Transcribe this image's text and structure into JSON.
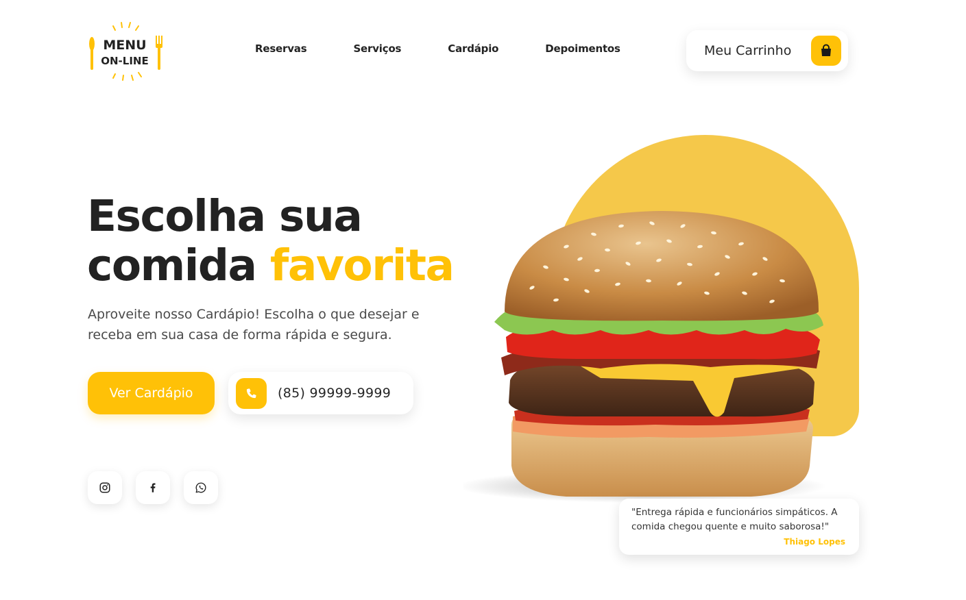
{
  "logo": {
    "line1": "MENU",
    "line2": "ON-LINE"
  },
  "nav": {
    "items": [
      {
        "label": "Reservas"
      },
      {
        "label": "Serviços"
      },
      {
        "label": "Cardápio"
      },
      {
        "label": "Depoimentos"
      }
    ]
  },
  "cart": {
    "label": "Meu Carrinho",
    "icon": "shopping-bag-icon"
  },
  "hero": {
    "title_line1": "Escolha sua",
    "title_line2_plain": "comida ",
    "title_line2_accent": "favorita",
    "subtitle": "Aproveite nosso Cardápio! Escolha o que desejar e receba em sua casa de forma rápida e segura.",
    "cta_label": "Ver Cardápio",
    "phone": "(85) 99999-9999"
  },
  "social": [
    {
      "icon": "instagram-icon"
    },
    {
      "icon": "facebook-icon"
    },
    {
      "icon": "whatsapp-icon"
    }
  ],
  "testimonial": {
    "quote": "\"Entrega rápida e funcionários simpáticos. A comida chegou quente e muito saborosa!\"",
    "author": "Thiago Lopes"
  },
  "colors": {
    "accent": "#FFC107",
    "shape": "#F5C84A",
    "text": "#222222"
  }
}
